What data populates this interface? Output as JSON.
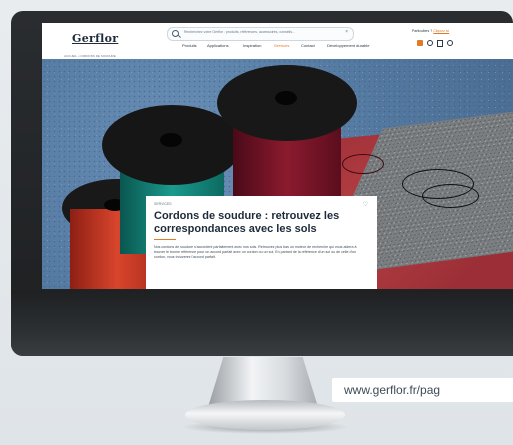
{
  "site": {
    "logo": "Gerflor",
    "search_placeholder": "Recherchez votre Gerflor : produits, références, accessoires, conseils…",
    "search_clear": "×",
    "nav": [
      "Produits",
      "Applications",
      "Inspiration",
      "Services",
      "Contact",
      "Développement durable"
    ],
    "active_nav": "Services",
    "top_cta_prefix": "Particuliers ?",
    "top_cta_link": "Cliquez ici",
    "breadcrumb": "ACCUEIL › CORDONS DE SOUDURE",
    "accent_color": "#e07b2a"
  },
  "article": {
    "kicker": "SERVICES",
    "title": "Cordons de soudure : retrouvez les correspondances avec les sols",
    "body": "Nos cordons de soudure s'accordent parfaitement avec nos sols. Retrouvez plus bas un moteur de recherche qui vous aidera à trouver le bonne référence pour un accord parfait avec un cordon ou un sol. En partant de la référence d'un sol ou de celle d'un cordon, vous trouverez l'accord parfait."
  },
  "url_caption": "www.gerflor.fr/pag"
}
